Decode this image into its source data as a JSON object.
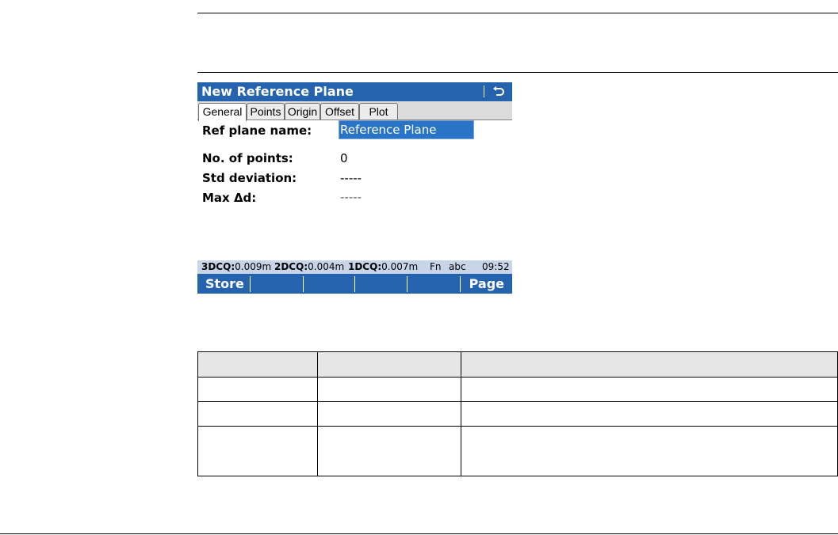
{
  "screen": {
    "title": "New Reference Plane",
    "back_icon": "back-arrow-icon",
    "tabs": [
      "General",
      "Points",
      "Origin",
      "Offset",
      "Plot"
    ],
    "active_tab": "General",
    "fields": {
      "ref_plane_name": {
        "label": "Ref plane name:",
        "value": "Reference Plane"
      },
      "no_of_points": {
        "label": "No. of points:",
        "value": "0"
      },
      "std_deviation": {
        "label": "Std deviation:",
        "value": "-----"
      },
      "max_delta_d": {
        "label": "Max Δd:",
        "value": "-----"
      }
    },
    "status": {
      "q3d_label": "3DCQ:",
      "q3d_value": "0.009m",
      "q2d_label": "2DCQ:",
      "q2d_value": "0.004m",
      "q1d_label": "1DCQ:",
      "q1d_value": "0.007m",
      "fn": "Fn",
      "input_mode": "abc",
      "time": "09:52"
    },
    "softkeys": [
      "Store",
      "",
      "",
      "",
      "",
      "Page"
    ],
    "colors": {
      "title_bar": "#2563ae",
      "status_bar": "#c8d5e8",
      "input_highlight": "#2a74c7"
    }
  },
  "table": {
    "headers": [
      "",
      "",
      ""
    ],
    "rows": [
      [
        "",
        "",
        ""
      ],
      [
        "",
        "",
        ""
      ],
      [
        "",
        "",
        ""
      ]
    ]
  }
}
